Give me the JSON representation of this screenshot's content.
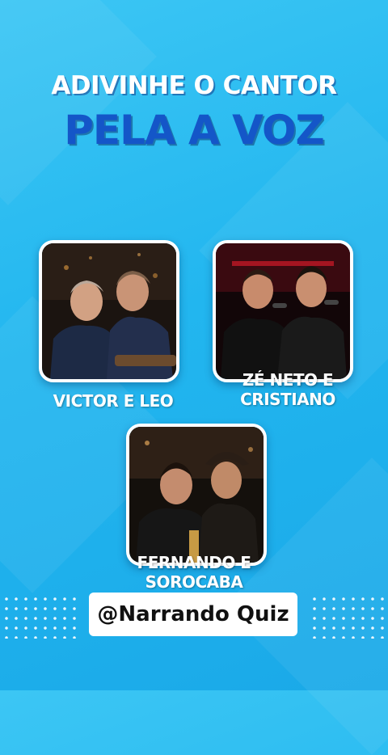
{
  "header": {
    "line1": "ADIVINHE O CANTOR",
    "line2": "PELA A VOZ"
  },
  "options": [
    {
      "caption_line1": "VICTOR E LEO",
      "caption_line2": ""
    },
    {
      "caption_line1": "ZÉ NETO E",
      "caption_line2": "CRISTIANO"
    },
    {
      "caption_line1": "FERNANDO E",
      "caption_line2": "SOROCABA"
    }
  ],
  "watermark": {
    "handle": "@Narrando Quiz"
  },
  "colors": {
    "background": "#22b6ef",
    "title_white": "#ffffff",
    "title_blue": "#1456c8",
    "card_border": "#ffffff"
  }
}
